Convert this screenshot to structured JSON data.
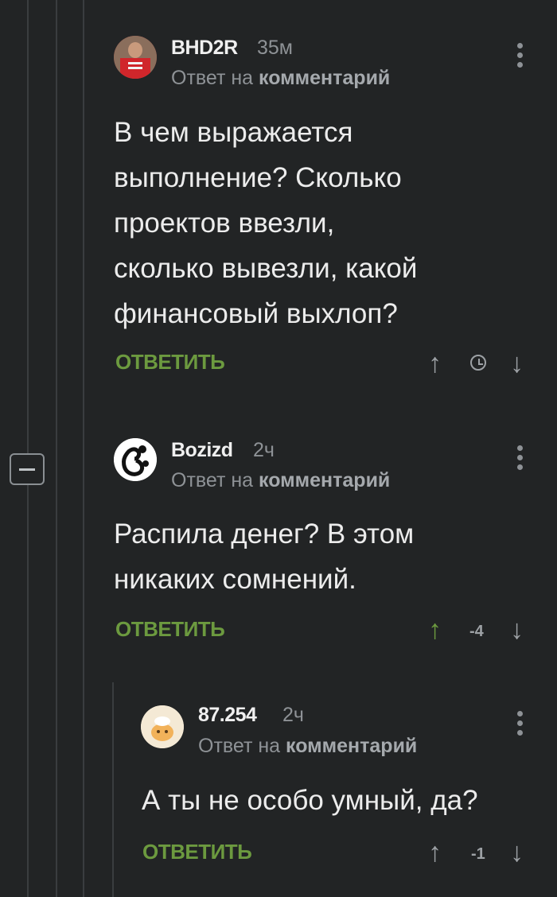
{
  "comments": [
    {
      "author": "BHD2R",
      "time": "35м",
      "reply_prefix": "Ответ на",
      "reply_target": "комментарий",
      "body_lines": [
        "В чем выражается",
        "выполнение? Сколько",
        "проектов ввезли,",
        "сколько вывезли, какой",
        "финансовый выхлоп?"
      ],
      "reply_label": "ОТВЕТИТЬ",
      "score": "",
      "avatar_icon": "user-avatar-red"
    },
    {
      "author": "Bozizd",
      "time": "2ч",
      "reply_prefix": "Ответ на",
      "reply_target": "комментарий",
      "body_lines": [
        "Распила денег? В этом",
        "никаких сомнений."
      ],
      "reply_label": "ОТВЕТИТЬ",
      "score": "-4",
      "avatar_icon": "scorpion-avatar"
    },
    {
      "author": "87.254",
      "time": "2ч",
      "reply_prefix": "Ответ на",
      "reply_target": "комментарий",
      "body_lines": [
        "А ты не особо умный, да?"
      ],
      "reply_label": "ОТВЕТИТЬ",
      "score": "-1",
      "avatar_icon": "default-cat-avatar"
    }
  ],
  "colors": {
    "background": "#222425",
    "accent_green": "#6c9a3f",
    "muted_text": "#8e9296"
  }
}
